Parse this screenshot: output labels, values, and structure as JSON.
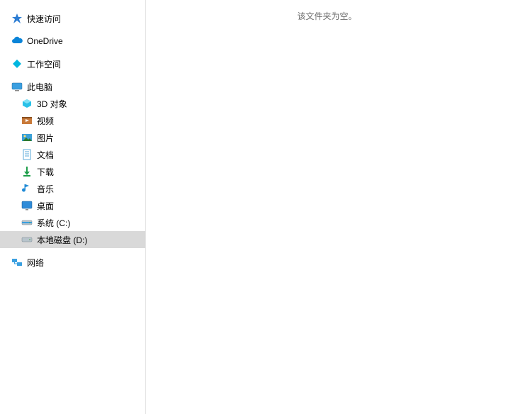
{
  "sidebar": {
    "quick_access": "快速访问",
    "onedrive": "OneDrive",
    "workspace": "工作空间",
    "this_pc": "此电脑",
    "children": {
      "objects3d": "3D 对象",
      "videos": "视频",
      "pictures": "图片",
      "documents": "文档",
      "downloads": "下载",
      "music": "音乐",
      "desktop": "桌面",
      "system_c": "系统 (C:)",
      "local_d": "本地磁盘 (D:)"
    },
    "network": "网络"
  },
  "content": {
    "empty_message": "该文件夹为空。"
  },
  "state": {
    "selected": "local_d"
  }
}
